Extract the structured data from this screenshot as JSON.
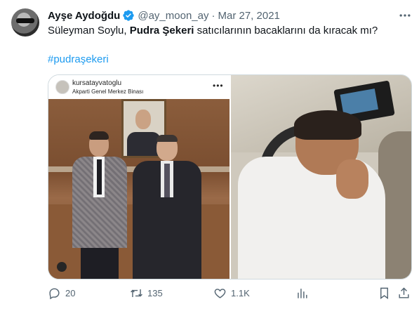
{
  "tweet": {
    "author_name": "Ayşe Aydoğdu",
    "handle": "@ay_moon_ay",
    "separator": "·",
    "date": "Mar 27, 2021",
    "text_part1": "Süleyman Soylu, ",
    "text_bold": "Pudra Şekeri",
    "text_part2": " satıcılarının bacaklarını da kıracak mı?",
    "hashtag": "#pudraşekeri"
  },
  "media": {
    "image1": {
      "username": "kursatayvatoglu",
      "location": "Akparti Genel Merkez Binası",
      "more_dots": "•••"
    }
  },
  "actions": {
    "reply_count": "20",
    "retweet_count": "135",
    "like_count": "1.1K"
  },
  "colors": {
    "text": "#0f1419",
    "muted": "#536471",
    "accent": "#1d9bf0",
    "border": "#cfd9de"
  },
  "icons": {
    "verified": "verified-badge-icon",
    "more": "more-horizontal-icon",
    "reply": "reply-icon",
    "retweet": "retweet-icon",
    "like": "heart-icon",
    "views": "bar-chart-icon",
    "bookmark": "bookmark-icon",
    "share": "share-icon"
  }
}
